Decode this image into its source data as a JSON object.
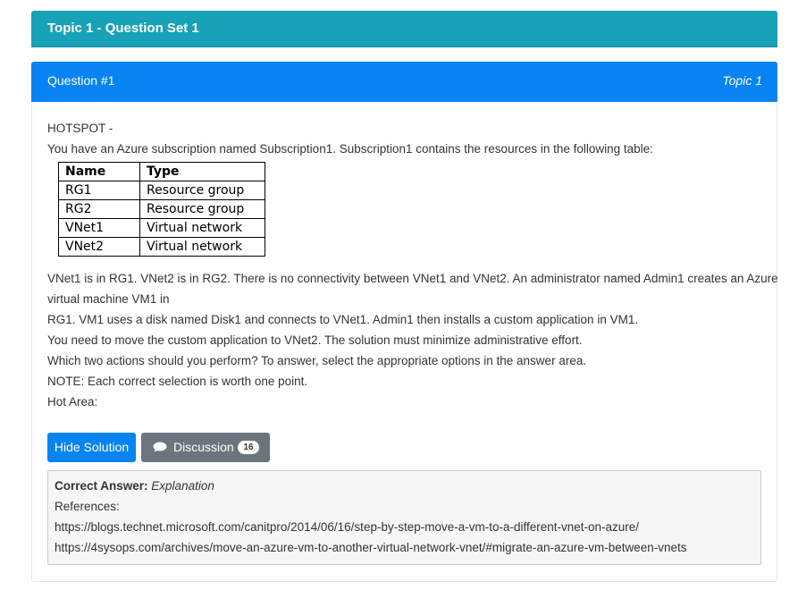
{
  "topic_header": {
    "title": "Topic 1 - Question Set 1"
  },
  "question": {
    "title": "Question #1",
    "topic": "Topic 1",
    "type_label": "HOTSPOT -",
    "intro": "You have an Azure subscription named Subscription1. Subscription1 contains the resources in the following table:",
    "table": {
      "headers": [
        "Name",
        "Type"
      ],
      "rows": [
        [
          "RG1",
          "Resource group"
        ],
        [
          "RG2",
          "Resource group"
        ],
        [
          "VNet1",
          "Virtual network"
        ],
        [
          "VNet2",
          "Virtual network"
        ]
      ]
    },
    "paragraphs": [
      "VNet1 is in RG1. VNet2 is in RG2. There is no connectivity between VNet1 and VNet2. An administrator named Admin1 creates an Azure",
      "virtual machine VM1 in",
      "RG1. VM1 uses a disk named Disk1 and connects to VNet1. Admin1 then installs a custom application in VM1.",
      "You need to move the custom application to VNet2. The solution must minimize administrative effort.",
      "Which two actions should you perform? To answer, select the appropriate options in the answer area.",
      "NOTE: Each correct selection is worth one point.",
      "Hot Area:"
    ]
  },
  "buttons": {
    "hide_solution": "Hide Solution",
    "discussion": "Discussion",
    "discussion_count": "16"
  },
  "answer": {
    "label": "Correct Answer:",
    "value": "Explanation",
    "references_label": "References:",
    "links": [
      "https://blogs.technet.microsoft.com/canitpro/2014/06/16/step-by-step-move-a-vm-to-a-different-vnet-on-azure/",
      "https://4sysops.com/archives/move-an-azure-vm-to-another-virtual-network-vnet/#migrate-an-azure-vm-between-vnets"
    ]
  },
  "colors": {
    "topic_bar": "#17a2b8",
    "question_header": "#0784f1",
    "secondary_button": "#6c757d"
  }
}
